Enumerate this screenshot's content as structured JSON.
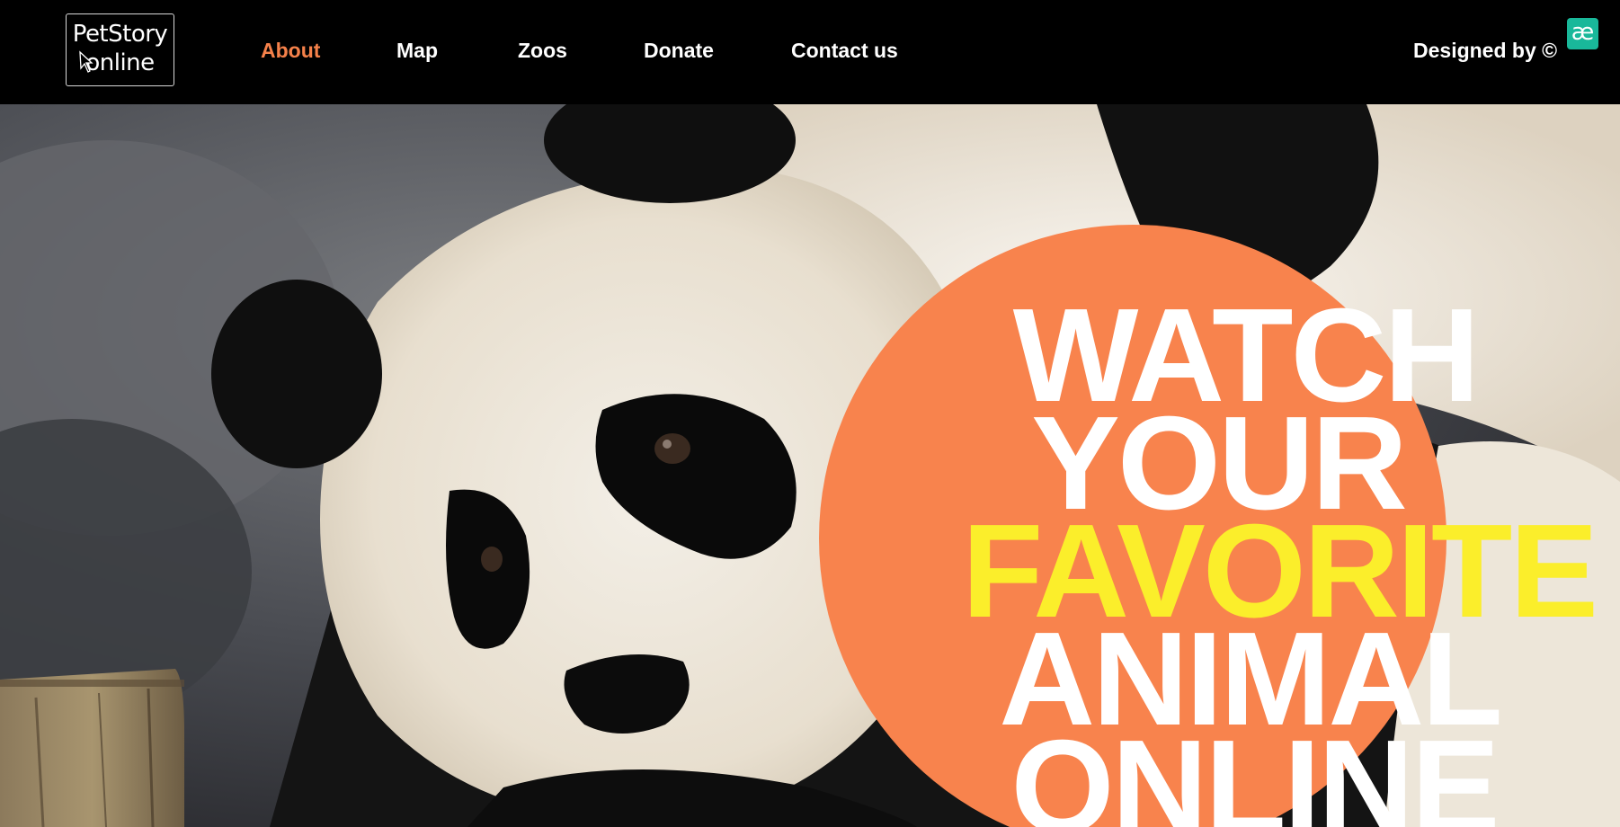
{
  "logo": {
    "line1": "PetStory",
    "line2": "online"
  },
  "nav": {
    "items": [
      {
        "label": "About",
        "active": true
      },
      {
        "label": "Map",
        "active": false
      },
      {
        "label": "Zoos",
        "active": false
      },
      {
        "label": "Donate",
        "active": false
      },
      {
        "label": "Contact us",
        "active": false
      }
    ]
  },
  "credit": {
    "label": "Designed by ©",
    "badge": "æ"
  },
  "hero": {
    "image_subject": "giant panda",
    "headline": [
      "WATCH",
      "YOUR",
      "FAVORITE",
      "ANIMAL",
      "ONLINE"
    ],
    "highlight_word": "FAVORITE"
  },
  "colors": {
    "accent": "#f5814a",
    "circle": "#f8834d",
    "highlight": "#fbee2b",
    "badge": "#19b89a",
    "navbar": "#000000"
  }
}
